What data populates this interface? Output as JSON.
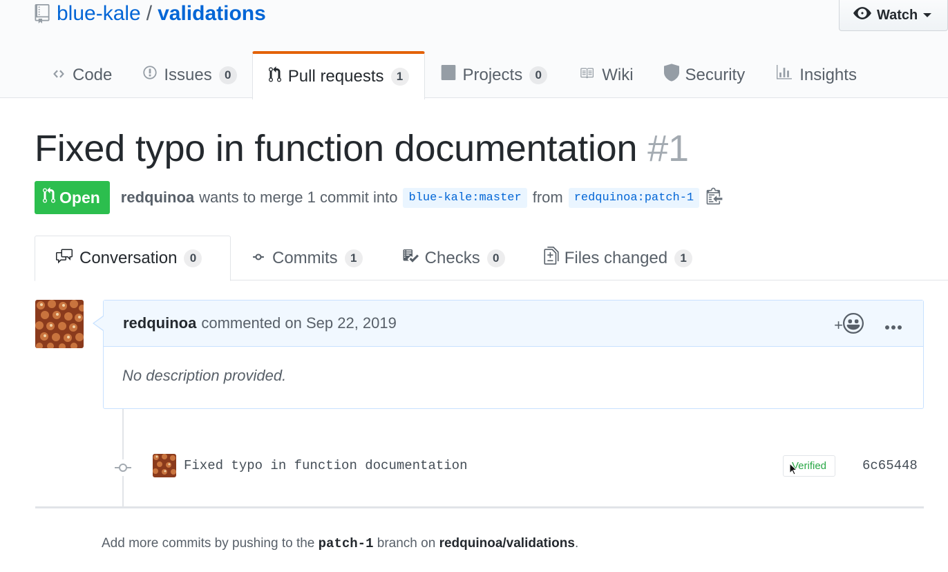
{
  "repo": {
    "owner": "blue-kale",
    "separator": "/",
    "name": "validations",
    "watch_label": "Watch"
  },
  "reponav": [
    {
      "label": "Code",
      "icon": "code-icon",
      "counter": null
    },
    {
      "label": "Issues",
      "icon": "issue-icon",
      "counter": "0"
    },
    {
      "label": "Pull requests",
      "icon": "git-pull-request-icon",
      "counter": "1",
      "selected": true
    },
    {
      "label": "Projects",
      "icon": "project-icon",
      "counter": "0"
    },
    {
      "label": "Wiki",
      "icon": "book-icon",
      "counter": null
    },
    {
      "label": "Security",
      "icon": "shield-icon",
      "counter": null
    },
    {
      "label": "Insights",
      "icon": "graph-icon",
      "counter": null
    }
  ],
  "pr": {
    "title": "Fixed typo in function documentation",
    "number": "#1",
    "state": "Open",
    "author": "redquinoa",
    "merge_text": "wants to merge 1 commit into",
    "base_branch": "blue-kale:master",
    "from_text": "from",
    "head_branch": "redquinoa:patch-1"
  },
  "tabs": [
    {
      "label": "Conversation",
      "icon": "comment-discussion-icon",
      "counter": "0",
      "selected": true
    },
    {
      "label": "Commits",
      "icon": "git-commit-icon",
      "counter": "1"
    },
    {
      "label": "Checks",
      "icon": "checklist-icon",
      "counter": "0"
    },
    {
      "label": "Files changed",
      "icon": "file-diff-icon",
      "counter": "1"
    }
  ],
  "comment": {
    "author": "redquinoa",
    "action": "commented on Sep 22, 2019",
    "reaction_plus": "+",
    "body": "No description provided."
  },
  "commit": {
    "message": "Fixed typo in function documentation",
    "verified": "Verified",
    "sha": "6c65448"
  },
  "footer": {
    "prefix": "Add more commits by pushing to the",
    "branch": "patch-1",
    "middle": "branch on",
    "repo": "redquinoa/validations",
    "suffix": "."
  },
  "colors": {
    "link": "#0366d6",
    "open_green": "#2cbe4e",
    "selected_tab_accent": "#e36209",
    "verified_green": "#28a745"
  }
}
